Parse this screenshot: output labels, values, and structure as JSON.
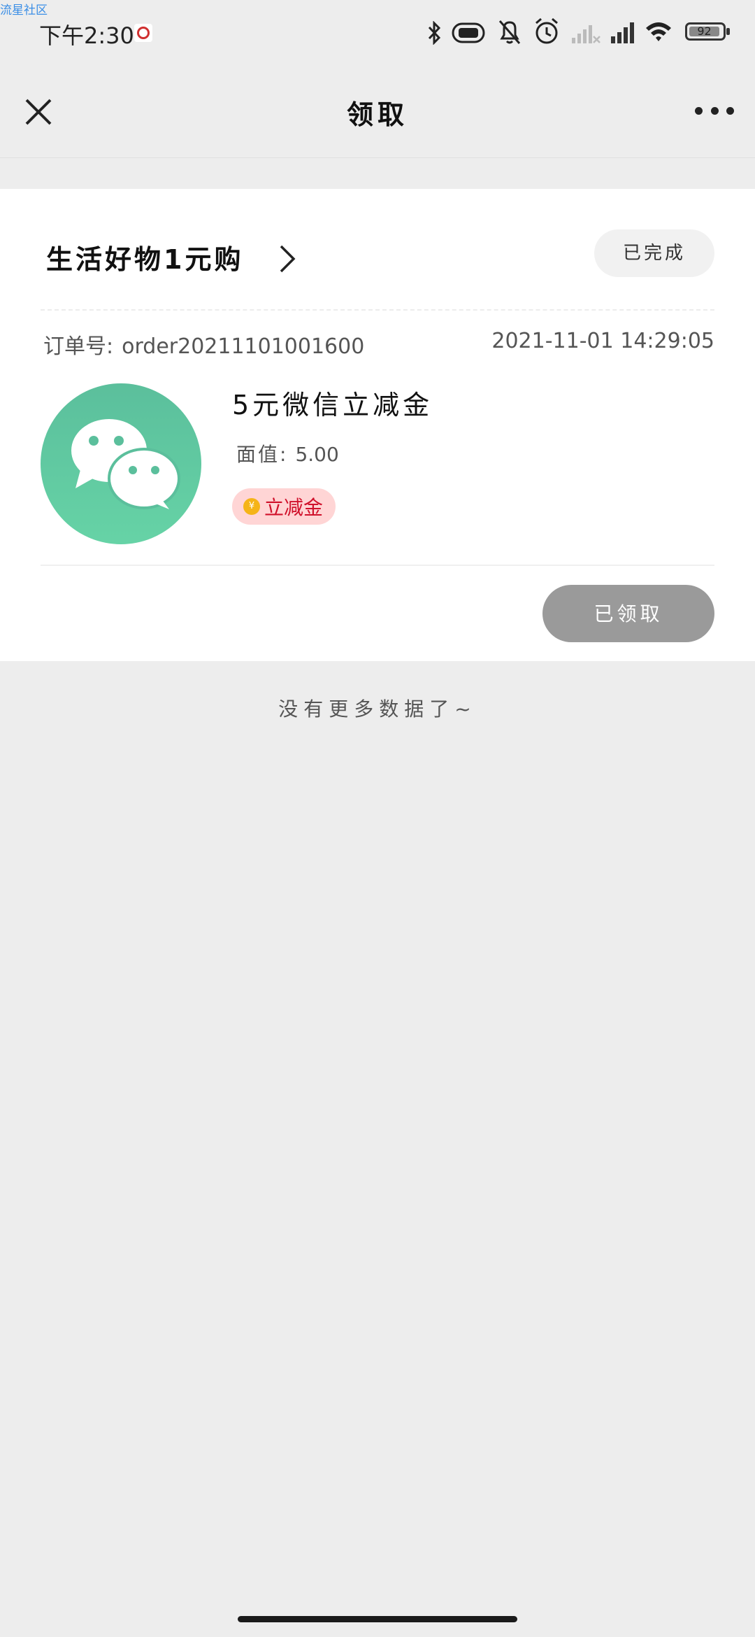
{
  "watermark": "流星社区",
  "status_bar": {
    "time": "下午2:30",
    "battery": "92"
  },
  "nav": {
    "title": "领取"
  },
  "order": {
    "shop_name": "生活好物1元购",
    "status": "已完成",
    "order_label": "订单号:",
    "order_number": "order20211101001600",
    "datetime": "2021-11-01 14:29:05",
    "product_title": "5元微信立减金",
    "value_label": "面值:",
    "value": "5.00",
    "tag": "立减金",
    "tag_coin": "¥",
    "action_label": "已领取"
  },
  "footer": {
    "no_more": "没有更多数据了~"
  },
  "colors": {
    "thumb_green": "#5bbf9c",
    "tag_red": "#d0112b",
    "tag_bg": "#ffd5d5",
    "button_grey": "#9a9a9a"
  }
}
